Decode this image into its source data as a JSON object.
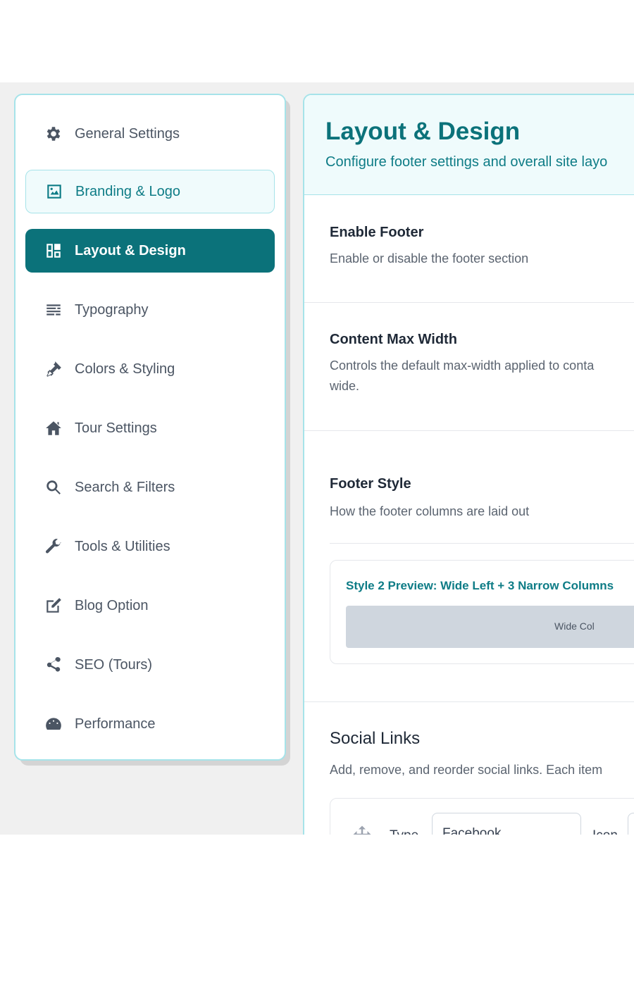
{
  "sidebar": {
    "items": [
      {
        "label": "General Settings",
        "icon": "gear-icon"
      },
      {
        "label": "Branding & Logo",
        "icon": "image-icon"
      },
      {
        "label": "Layout & Design",
        "icon": "layout-icon"
      },
      {
        "label": "Typography",
        "icon": "text-lines-icon"
      },
      {
        "label": "Colors & Styling",
        "icon": "brush-icon"
      },
      {
        "label": "Tour Settings",
        "icon": "home-icon"
      },
      {
        "label": "Search & Filters",
        "icon": "search-icon"
      },
      {
        "label": "Tools & Utilities",
        "icon": "wrench-icon"
      },
      {
        "label": "Blog Option",
        "icon": "edit-icon"
      },
      {
        "label": "SEO (Tours)",
        "icon": "share-icon"
      },
      {
        "label": "Performance",
        "icon": "gauge-icon"
      }
    ]
  },
  "main": {
    "title": "Layout & Design",
    "subtitle": "Configure footer settings and overall site layo",
    "enable_footer": {
      "title": "Enable Footer",
      "desc": "Enable or disable the footer section"
    },
    "content_max_width": {
      "title": "Content Max Width",
      "desc_line1": "Controls the default max-width applied to conta",
      "desc_line2": "wide."
    },
    "footer_style": {
      "title": "Footer Style",
      "desc": "How the footer columns are laid out",
      "preview_title": "Style 2 Preview: Wide Left + 3 Narrow Columns",
      "preview_col_label": "Wide Col"
    },
    "social_links": {
      "title": "Social Links",
      "desc": "Add, remove, and reorder social links. Each item",
      "type_label": "Type",
      "type_value": "Facebook",
      "icon_label": "Icon"
    }
  },
  "colors": {
    "accent": "#0b727a",
    "accent_light": "#effbfc",
    "border_accent": "#a6e3e9"
  }
}
